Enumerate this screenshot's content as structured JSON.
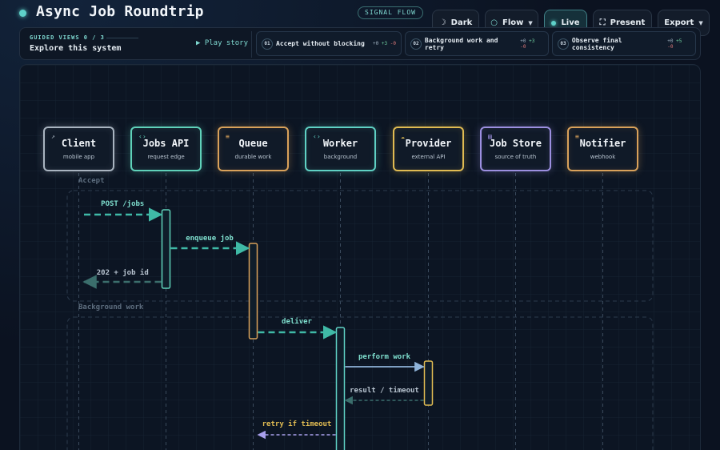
{
  "header": {
    "title": "Async Job Roundtrip",
    "badge": "SIGNAL FLOW"
  },
  "toolbar": {
    "theme": {
      "label": "Dark",
      "icon": "moon-icon"
    },
    "mode": {
      "label": "Flow",
      "icon": "circle-icon"
    },
    "live": {
      "label": "Live"
    },
    "present": {
      "label": "Present",
      "icon": "expand-icon"
    },
    "export": {
      "label": "Export"
    }
  },
  "guided": {
    "label": "GUIDED VIEWS 0 / 3",
    "subtitle": "Explore this system",
    "play": "▶ Play story",
    "steps": [
      {
        "num": "01",
        "label": "Accept without blocking",
        "meta_a": "+0",
        "meta_b": "+3",
        "meta_c": "-0"
      },
      {
        "num": "02",
        "label": "Background work and retry",
        "meta_a": "+0",
        "meta_b": "+3",
        "meta_c": "-0"
      },
      {
        "num": "03",
        "label": "Observe final consistency",
        "meta_a": "+0",
        "meta_b": "+5",
        "meta_c": "-0"
      }
    ]
  },
  "actors": [
    {
      "name": "Client",
      "sub": "mobile app",
      "color": "#a9b4c0",
      "icon": "external-link-icon",
      "glyph": "↗"
    },
    {
      "name": "Jobs API",
      "sub": "request edge",
      "color": "#5fd1b9",
      "icon": "code-icon",
      "glyph": "‹›"
    },
    {
      "name": "Queue",
      "sub": "durable work",
      "color": "#d9a15a",
      "icon": "list-icon",
      "glyph": "≡"
    },
    {
      "name": "Worker",
      "sub": "background",
      "color": "#5fd1c4",
      "icon": "code-icon",
      "glyph": "‹›"
    },
    {
      "name": "Provider",
      "sub": "external API",
      "color": "#e0bb52",
      "icon": "cloud-icon",
      "glyph": "☁"
    },
    {
      "name": "Job Store",
      "sub": "source of truth",
      "color": "#9c8fe0",
      "icon": "database-icon",
      "glyph": "▤"
    },
    {
      "name": "Notifier",
      "sub": "webhook",
      "color": "#d9a15a",
      "icon": "list-icon",
      "glyph": "≡"
    }
  ],
  "sections": [
    "Accept",
    "Background work"
  ],
  "messages": [
    {
      "label": "POST /jobs",
      "from": 0,
      "to": 1,
      "kind": "request"
    },
    {
      "label": "enqueue job",
      "from": 1,
      "to": 2,
      "kind": "request"
    },
    {
      "label": "202 + job id",
      "from": 1,
      "to": 0,
      "kind": "response"
    },
    {
      "label": "deliver",
      "from": 2,
      "to": 3,
      "kind": "request"
    },
    {
      "label": "perform work",
      "from": 3,
      "to": 4,
      "kind": "call"
    },
    {
      "label": "result / timeout",
      "from": 4,
      "to": 3,
      "kind": "response"
    },
    {
      "label": "retry if timeout",
      "from": 3,
      "to": 2,
      "kind": "retry"
    }
  ]
}
